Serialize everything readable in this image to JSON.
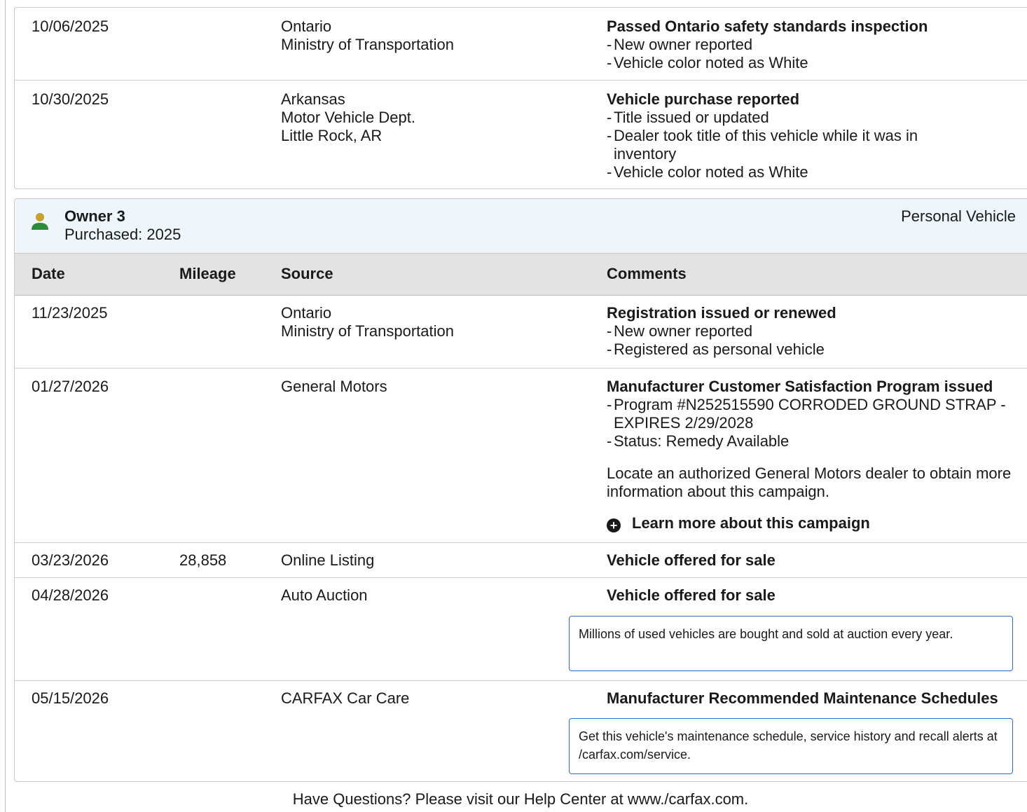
{
  "prev_records": [
    {
      "date": "10/06/2025",
      "mileage": "",
      "source": [
        "Ontario",
        "Ministry of Transportation"
      ],
      "comment_title": "Passed Ontario safety standards inspection",
      "comment_items": [
        "New owner reported",
        "Vehicle color noted as White"
      ]
    },
    {
      "date": "10/30/2025",
      "mileage": "",
      "source": [
        "Arkansas",
        "Motor Vehicle Dept.",
        "Little Rock, AR"
      ],
      "comment_title": "Vehicle purchase reported",
      "comment_items": [
        "Title issued or updated",
        "Dealer took title of this vehicle while it was in inventory",
        "Vehicle color noted as White"
      ]
    }
  ],
  "owner": {
    "name": "Owner 3",
    "purchased": "Purchased: 2025",
    "type": "Personal Vehicle",
    "icon": "person-icon"
  },
  "table_headers": [
    "Date",
    "Mileage",
    "Source",
    "Comments"
  ],
  "records": [
    {
      "date": "11/23/2025",
      "mileage": "",
      "source": [
        "Ontario",
        "Ministry of Transportation"
      ],
      "comment_title": "Registration issued or renewed",
      "comment_items": [
        "New owner reported",
        "Registered as personal vehicle"
      ]
    },
    {
      "date": "01/27/2026",
      "mileage": "",
      "source": [
        "General Motors"
      ],
      "comment_title": "Manufacturer Customer Satisfaction Program issued",
      "comment_items": [
        "Program #N252515590 CORRODED GROUND STRAP - EXPIRES 2/29/2028",
        "Status: Remedy Available"
      ],
      "note": "Locate an authorized General Motors dealer to obtain more information about this campaign.",
      "link": "Learn more about this campaign"
    },
    {
      "date": "03/23/2026",
      "mileage": "28,858",
      "source": [
        "Online Listing"
      ],
      "comment_title": "Vehicle offered for sale",
      "comment_items": []
    },
    {
      "date": "04/28/2026",
      "mileage": "",
      "source": [
        "Auto Auction"
      ],
      "comment_title": "Vehicle offered for sale",
      "comment_items": [],
      "infobox": "Millions of used vehicles are bought and sold at auction every year."
    },
    {
      "date": "05/15/2026",
      "mileage": "",
      "source": [
        "CARFAX Car Care"
      ],
      "comment_title": "Manufacturer Recommended Maintenance Schedules",
      "comment_items": [],
      "infobox": "Get this vehicle's maintenance schedule, service history and recall alerts at /carfax.com/service."
    }
  ],
  "footer": "Have Questions? Please visit our Help Center at www./carfax.com.",
  "colors": {
    "owner_bg": "#eef5fb",
    "header_bg": "#e3e3e3",
    "infobox_border": "#2a6fc4",
    "icon_head": "#c9a227",
    "icon_body": "#2e8b3a"
  }
}
